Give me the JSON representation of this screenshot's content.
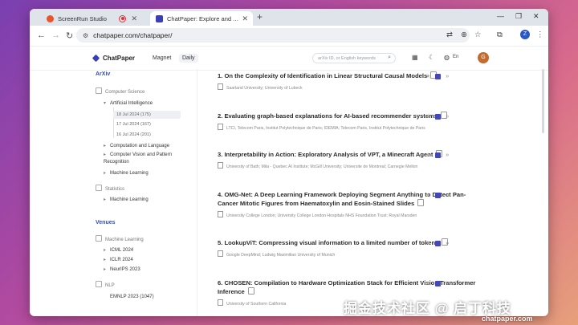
{
  "tabs": [
    {
      "title": "ScreenRun Studio",
      "active": false
    },
    {
      "title": "ChatPaper: Explore and AI C",
      "active": true
    }
  ],
  "browser": {
    "url": "chatpaper.com/chatpaper/",
    "profile_initial": "Z"
  },
  "app": {
    "name": "ChatPaper",
    "nav": [
      {
        "label": "Magnet"
      },
      {
        "label": "Daily"
      }
    ],
    "search_placeholder": "arXiv ID, or English keywords",
    "lang_label": "En",
    "user_initial": "G"
  },
  "sidebar": {
    "arxiv_title": "ArXiv",
    "cs_label": "Computer Science",
    "ai_label": "Artificial Intelligence",
    "dates": [
      "18 Jul 2024 (175)",
      "17 Jul 2024 (167)",
      "16 Jul 2024 (201)"
    ],
    "cs_items": [
      "Computation and Language",
      "Computer Vision and Pattern Recognition",
      "Machine Learning"
    ],
    "stats_label": "Statistics",
    "stats_items": [
      "Machine Learning"
    ],
    "venues_title": "Venues",
    "ml_label": "Machine Learning",
    "ml_items": [
      "ICML 2024",
      "ICLR 2024",
      "NeurIPS 2023"
    ],
    "nlp_label": "NLP",
    "nlp_items": [
      "EMNLP 2023 (1047)"
    ]
  },
  "papers": [
    {
      "title": "1. On the Complexity of Identification in Linear Structural Causal Models",
      "affil": "Saarland University; University of Lubeck"
    },
    {
      "title": "2. Evaluating graph-based explanations for AI-based recommender systems",
      "affil": "LTCI, Telecom Paris, Institut Polytechnique de Paris; IDEMIA; Telecom Paris, Institut Polytechnique de Paris"
    },
    {
      "title": "3. Interpretability in Action: Exploratory Analysis of VPT, a Minecraft Agent",
      "affil": "University of Bath; Mila - Quebec AI Institute; McGill University; Universite de Montreal; Carnegie Mellon"
    },
    {
      "title": "4. OMG-Net: A Deep Learning Framework Deploying Segment Anything to Detect Pan-Cancer Mitotic Figures from Haematoxylin and Eosin-Stained Slides",
      "affil": "University College London; University College London Hospitals NHS Foundation Trust; Royal Marsden"
    },
    {
      "title": "5. LookupViT: Compressing visual information to a limited number of tokens",
      "affil": "Google DeepMind; Ludwig Maximilian University of Munich"
    },
    {
      "title": "6. CHOSEN: Compilation to Hardware Optimization Stack for Efficient Vision Transformer Inference",
      "affil": "University of Southern California"
    }
  ],
  "watermark": {
    "main": "掘金技术社区 @ 启丁科技",
    "sub": "chatpaper.com"
  }
}
